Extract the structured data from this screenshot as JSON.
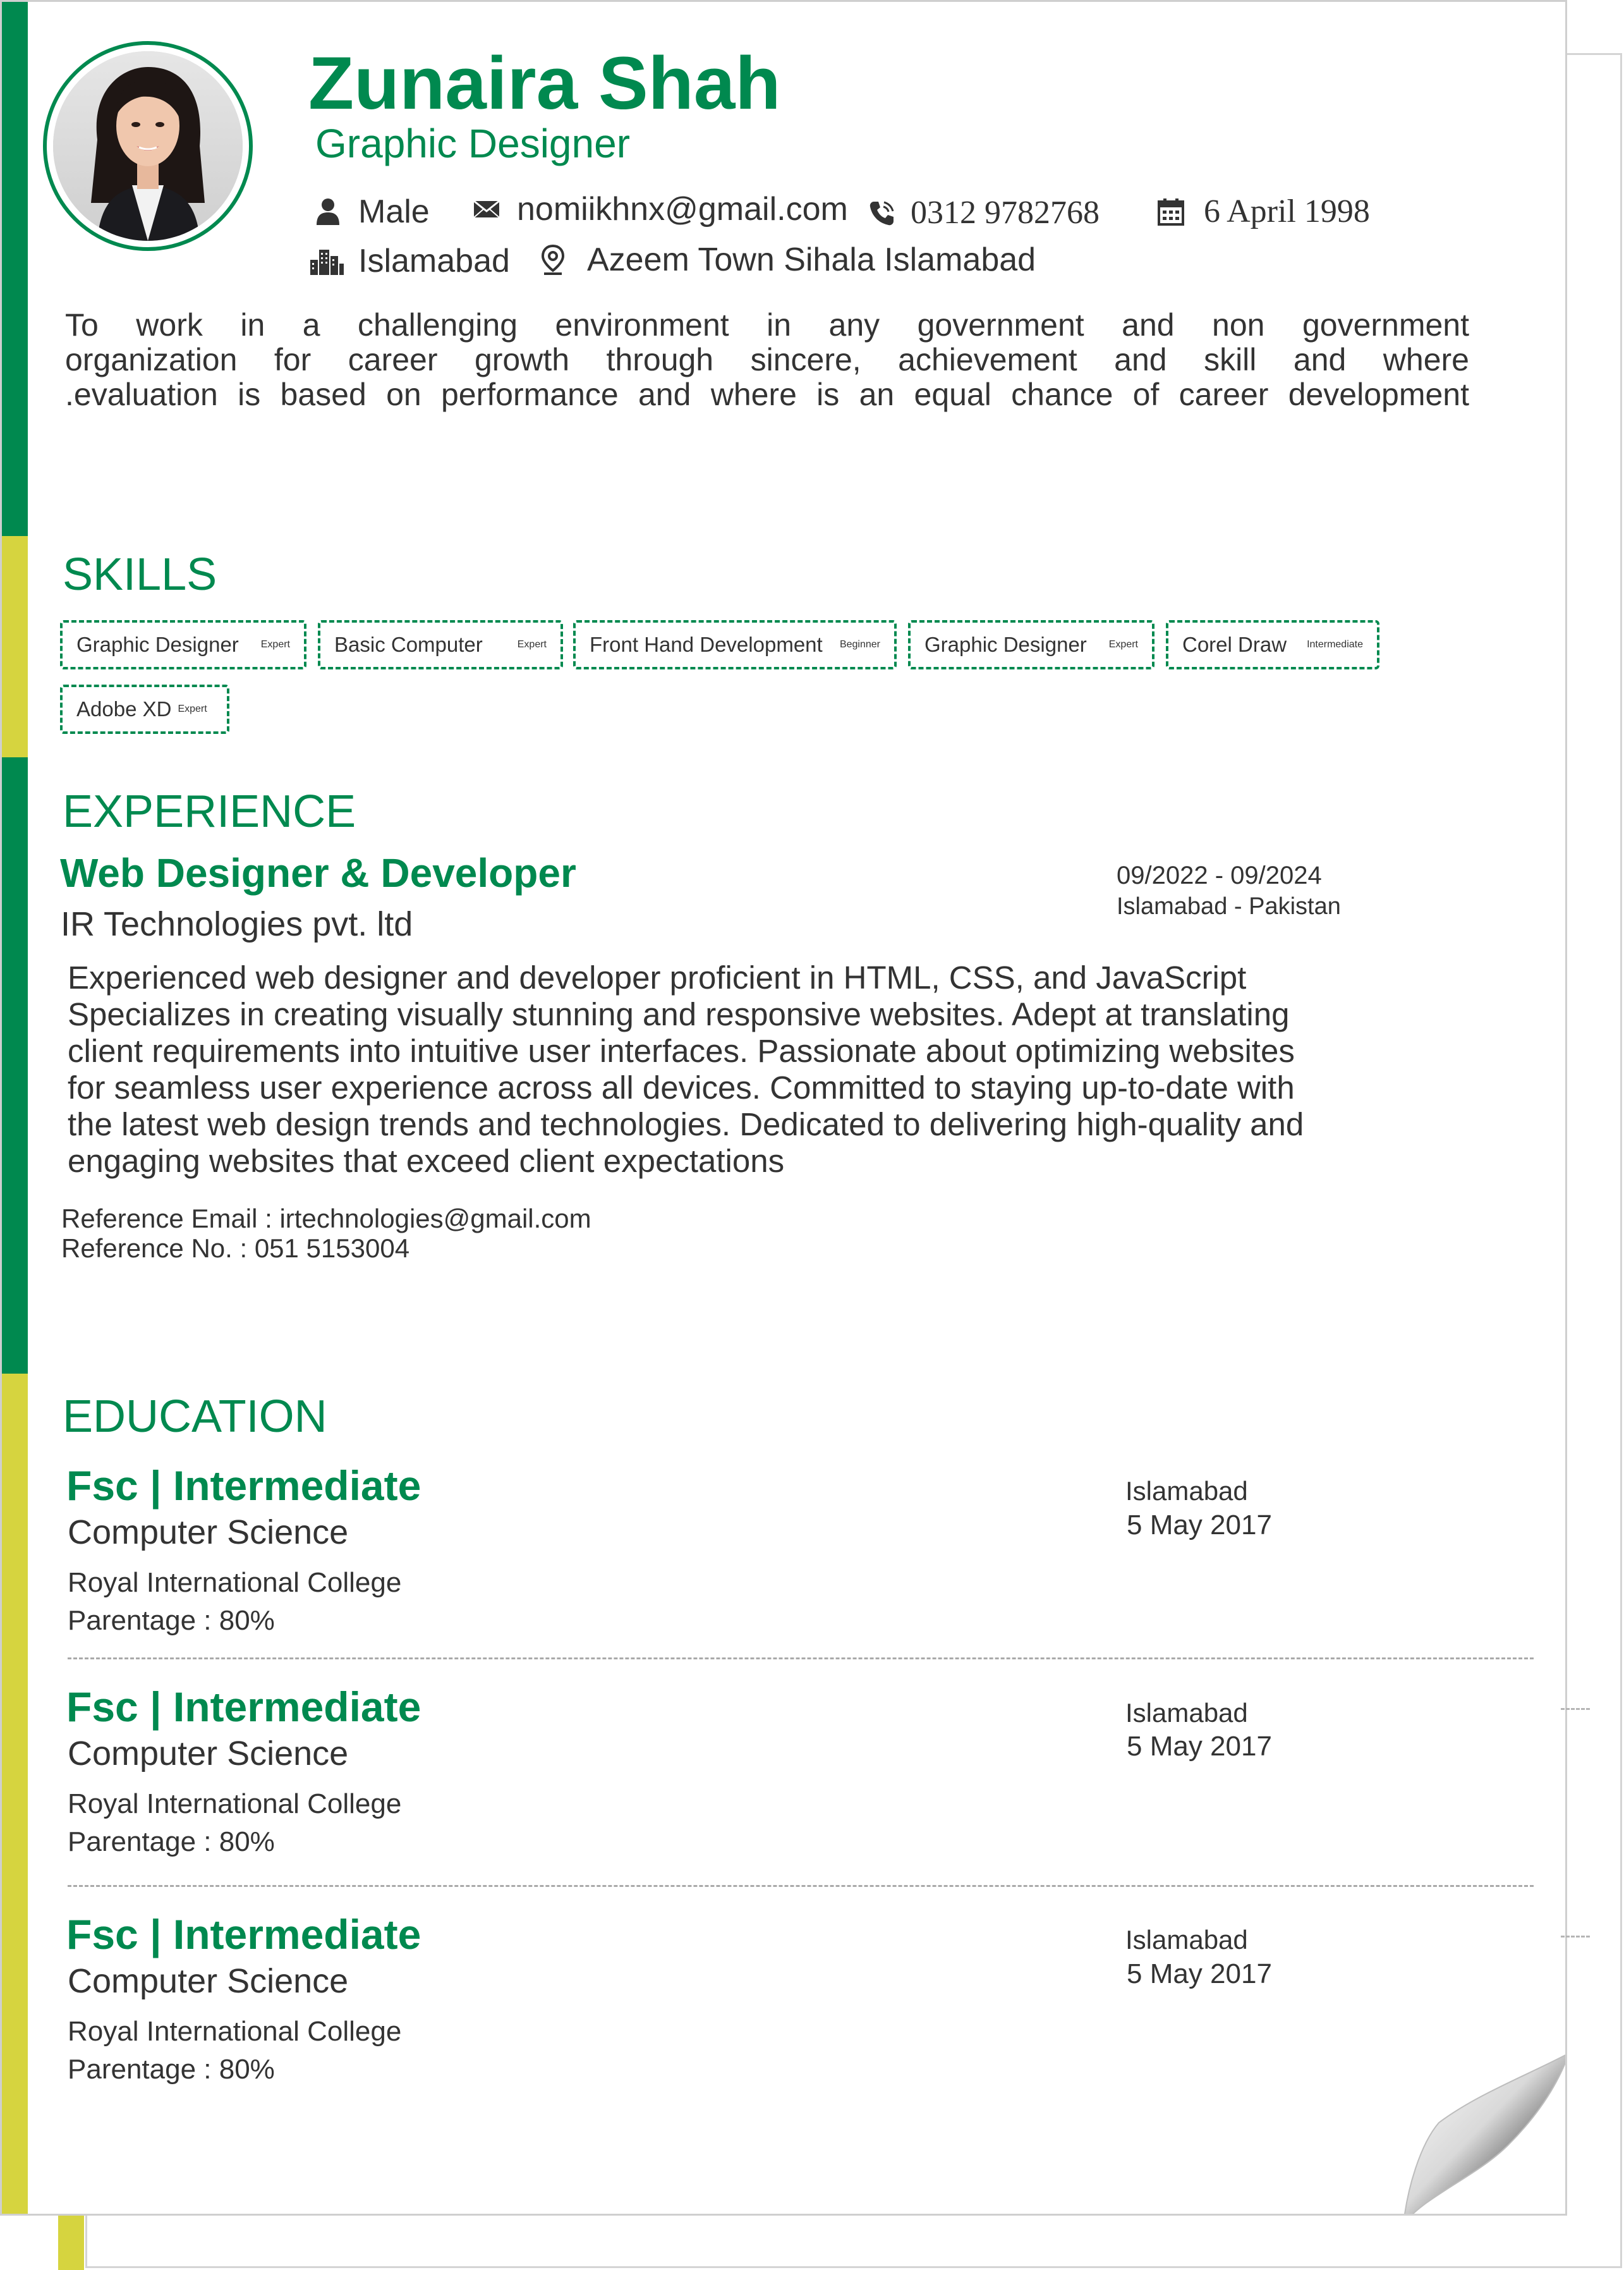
{
  "header": {
    "name": "Zunaira Shah",
    "title": "Graphic Designer",
    "gender": "Male",
    "email": "nomiikhnx@gmail.com",
    "phone": "0312 9782768",
    "dob": "6 April 1998",
    "city": "Islamabad",
    "address": "Azeem Town Sihala Islamabad"
  },
  "objective": {
    "lines": [
      "To work in a challenging environment in any government and non government",
      "organization for career growth through sincere, achievement and skill and where",
      ".evaluation is based on performance and where is an equal chance of career development"
    ]
  },
  "skills": {
    "heading": "SKILLS",
    "items": [
      {
        "name": "Graphic Designer",
        "level": "Expert"
      },
      {
        "name": "Basic Computer",
        "level": "Expert"
      },
      {
        "name": "Front Hand Development",
        "level": "Beginner"
      },
      {
        "name": "Graphic Designer",
        "level": "Expert"
      },
      {
        "name": "Corel Draw",
        "level": "Intermediate"
      },
      {
        "name": "Adobe XD",
        "level": "Expert"
      }
    ]
  },
  "experience": {
    "heading": "EXPERIENCE",
    "job_title": "Web Designer & Developer",
    "company": "IR Technologies pvt. ltd",
    "dates": "09/2022 - 09/2024",
    "location": "Islamabad - Pakistan",
    "description": [
      "Experienced web designer and developer proficient in  HTML, CSS, and JavaScript",
      "Specializes in creating  visually stunning and responsive websites. Adept at translating",
      "client requirements into intuitive user interfaces. Passionate about optimizing websites",
      "for seamless user experience across all devices. Committed to staying up-to-date with",
      "the latest web design trends and technologies. Dedicated to delivering high-quality and",
      "engaging websites that exceed client expectations"
    ],
    "reference_email": "Reference Email : irtechnologies@gmail.com",
    "reference_no": "Reference No. : 051 5153004"
  },
  "education": {
    "heading": "EDUCATION",
    "items": [
      {
        "degree": "Fsc | Intermediate",
        "field": "Computer Science",
        "institution": "Royal International College",
        "percentage": "Parentage : 80%",
        "city": "Islamabad",
        "date": "5 May 2017"
      },
      {
        "degree": "Fsc | Intermediate",
        "field": "Computer Science",
        "institution": "Royal International College",
        "percentage": "Parentage : 80%",
        "city": "Islamabad",
        "date": "5 May 2017"
      },
      {
        "degree": "Fsc | Intermediate",
        "field": "Computer Science",
        "institution": "Royal International College",
        "percentage": "Parentage : 80%",
        "city": "Islamabad",
        "date": "5 May 2017"
      }
    ]
  },
  "colors": {
    "accent": "#00894f",
    "accent_secondary": "#d6d43f",
    "text": "#333333"
  },
  "icons": [
    "person-icon",
    "envelope-icon",
    "phone-icon",
    "calendar-icon",
    "buildings-icon",
    "location-pin-icon"
  ]
}
